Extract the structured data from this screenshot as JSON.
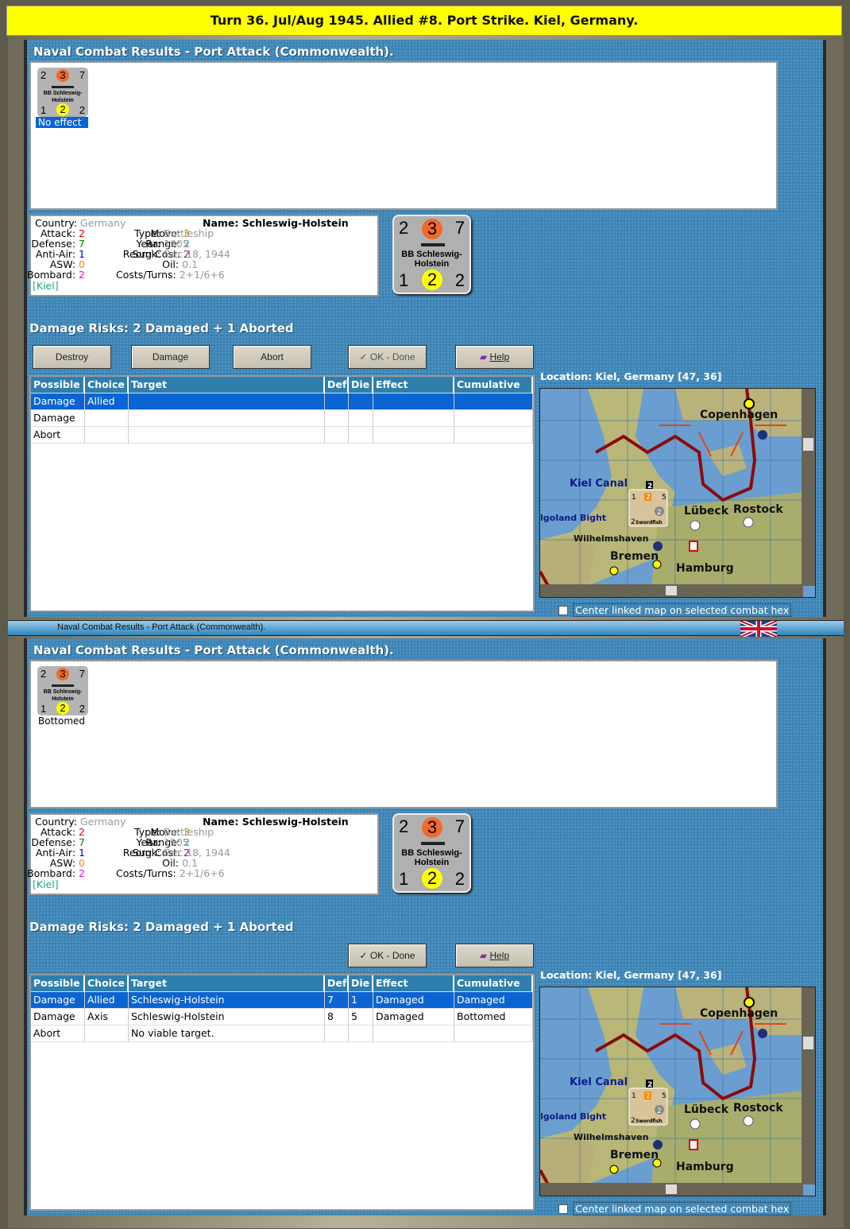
{
  "banner": "Turn 36.  Jul/Aug 1945.  Allied #8.  Port Strike.  Kiel, Germany.",
  "divider_title": "Naval Combat Results - Port Attack (Commonwealth).",
  "colors": {
    "banner": "#ffff00",
    "panel": "#3f86b6",
    "selected": "#0a64d2",
    "header": "#2f7fae"
  },
  "panels": [
    {
      "title": "Naval Combat Results - Port Attack (Commonwealth).",
      "unit": {
        "tl": "2",
        "tc": "3",
        "tr": "7",
        "name": "BB Schleswig-Holstein",
        "bl": "1",
        "bc": "2",
        "br": "2",
        "result": "No effect",
        "selected": true
      },
      "info": {
        "country_l": "Country:",
        "country": "Germany",
        "attack_l": "Attack:",
        "attack": "2",
        "defense_l": "Defense:",
        "defense": "7",
        "aa_l": "Anti-Air:",
        "aa": "1",
        "asw_l": "ASW:",
        "asw": "0",
        "bombard_l": "Bombard:",
        "bombard": "2",
        "location": "[Kiel]",
        "move_l": "Move:",
        "move": "3",
        "range_l": "Range:",
        "range": "2",
        "reorg_l": "Reorg Cost:",
        "reorg": "2",
        "oil_l": "Oil:",
        "oil": "0.1",
        "costs_l": "Costs/Turns:",
        "costs": "2+1/6+6",
        "name_l": "Name:",
        "name": "Schleswig-Holstein",
        "type_l": "Type:",
        "type": "Battleship",
        "year_l": "Year:",
        "year": "1905",
        "sunk_l": "Sunk:",
        "sunk": "Dec 18, 1944"
      },
      "damage_risks": "Damage Risks:  2 Damaged + 1 Aborted",
      "buttons": [
        {
          "label": "Destroy",
          "pos": 0
        },
        {
          "label": "Damage",
          "pos": 1
        },
        {
          "label": "Abort",
          "pos": 2
        },
        {
          "label": "✓ OK - Done",
          "pos": 3,
          "disabled": true
        },
        {
          "label": "Help",
          "pos": 4,
          "icon": "help-book-icon"
        }
      ],
      "columns": [
        "Possible",
        "Choice",
        "Target",
        "Def",
        "Die",
        "Effect",
        "Cumulative"
      ],
      "rows": [
        [
          "Damage",
          "Allied",
          "",
          "",
          "",
          "",
          ""
        ],
        [
          "Damage",
          "",
          "",
          "",
          "",
          "",
          ""
        ],
        [
          "Abort",
          "",
          "",
          "",
          "",
          "",
          ""
        ]
      ],
      "location": "Location:  Kiel, Germany [47, 36]",
      "checkbox": "Center linked map on selected combat hex"
    },
    {
      "title": "Naval Combat Results - Port Attack (Commonwealth).",
      "unit": {
        "tl": "2",
        "tc": "3",
        "tr": "7",
        "name": "BB Schleswig-Holstein",
        "bl": "1",
        "bc": "2",
        "br": "2",
        "result": "Bottomed",
        "selected": false
      },
      "info": {
        "country_l": "Country:",
        "country": "Germany",
        "attack_l": "Attack:",
        "attack": "2",
        "defense_l": "Defense:",
        "defense": "7",
        "aa_l": "Anti-Air:",
        "aa": "1",
        "asw_l": "ASW:",
        "asw": "0",
        "bombard_l": "Bombard:",
        "bombard": "2",
        "location": "[Kiel]",
        "move_l": "Move:",
        "move": "3",
        "range_l": "Range:",
        "range": "2",
        "reorg_l": "Reorg Cost:",
        "reorg": "2",
        "oil_l": "Oil:",
        "oil": "0.1",
        "costs_l": "Costs/Turns:",
        "costs": "2+1/6+6",
        "name_l": "Name:",
        "name": "Schleswig-Holstein",
        "type_l": "Type:",
        "type": "Battleship",
        "year_l": "Year:",
        "year": "1905",
        "sunk_l": "Sunk:",
        "sunk": "Dec 18, 1944"
      },
      "damage_risks": "Damage Risks:  2 Damaged + 1 Aborted",
      "buttons": [
        {
          "label": "✓ OK - Done",
          "pos": 3
        },
        {
          "label": "Help",
          "pos": 4,
          "icon": "help-book-icon"
        }
      ],
      "columns": [
        "Possible",
        "Choice",
        "Target",
        "Def",
        "Die",
        "Effect",
        "Cumulative"
      ],
      "rows": [
        [
          "Damage",
          "Allied",
          "Schleswig-Holstein",
          "7",
          "1",
          "Damaged",
          "Damaged"
        ],
        [
          "Damage",
          "Axis",
          "Schleswig-Holstein",
          "8",
          "5",
          "Damaged",
          "Bottomed"
        ],
        [
          "Abort",
          "",
          "No viable target.",
          "",
          "",
          "",
          ""
        ]
      ],
      "location": "Location:  Kiel, Germany [47, 36]",
      "checkbox": "Center linked map on selected combat hex"
    }
  ],
  "map": {
    "labels": [
      "Copenhagen",
      "Kiel Canal",
      "Lübeck",
      "Rostock",
      "lgoland Bight",
      "Wilhelmshaven",
      "Bremen",
      "Hamburg"
    ],
    "unit": {
      "tl": "1",
      "tc": "2",
      "tr": "5",
      "name": "Swordfish",
      "bl": "2",
      "badge": "2"
    },
    "stack": "2"
  }
}
